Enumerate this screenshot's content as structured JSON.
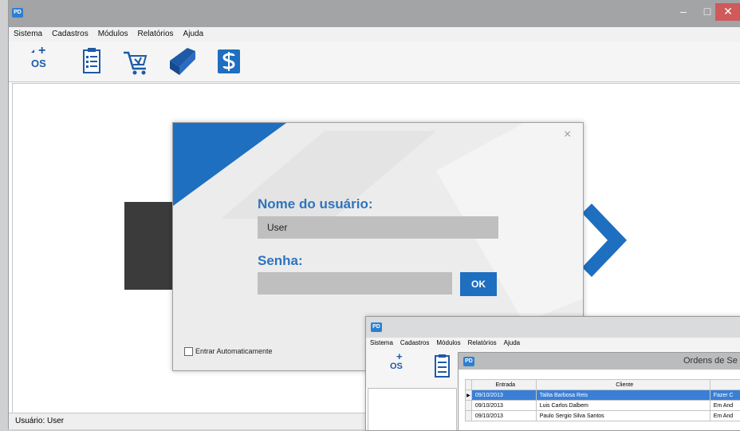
{
  "window": {
    "app_icon_text": "PD",
    "minimize": "–",
    "maximize": "□",
    "close": "✕"
  },
  "menu": [
    "Sistema",
    "Cadastros",
    "Módulos",
    "Relatórios",
    "Ajuda"
  ],
  "toolbar": {
    "os_plus": "+",
    "os_label": "OS",
    "icons": [
      "new-os-icon",
      "clipboard-checklist-icon",
      "shopping-cart-icon",
      "book-icon",
      "dollar-icon"
    ]
  },
  "status": {
    "user_text": "Usuário: User"
  },
  "login": {
    "close": "×",
    "username_label": "Nome do usuário:",
    "username_value": "User",
    "password_label": "Senha:",
    "ok_label": "OK",
    "auto_login_label": "Entrar Automaticamente"
  },
  "second_window": {
    "app_icon_text": "PD",
    "menu": [
      "Sistema",
      "Cadastros",
      "Módulos",
      "Relatórios",
      "Ajuda"
    ],
    "os_plus": "+",
    "os_label": "OS",
    "child": {
      "app_icon_text": "PD",
      "title": "Ordens de Se",
      "columns": [
        "Entrada",
        "Cliente",
        ""
      ],
      "rows": [
        {
          "marker": "▶",
          "entrada": "09/10/2013",
          "cliente": "Talita Barbosa Reis",
          "status": "Fazer C",
          "selected": true
        },
        {
          "marker": "",
          "entrada": "09/10/2013",
          "cliente": "Luis Carlos Dalbem",
          "status": "Em And",
          "selected": false
        },
        {
          "marker": "",
          "entrada": "09/10/2013",
          "cliente": "Paulo Sergio Silva Santos",
          "status": "Em And",
          "selected": false
        }
      ]
    }
  },
  "colors": {
    "accent": "#1e6fc0",
    "titlebar": "#a3a4a6",
    "selection": "#3a7fd6",
    "close": "#d05a5a"
  }
}
